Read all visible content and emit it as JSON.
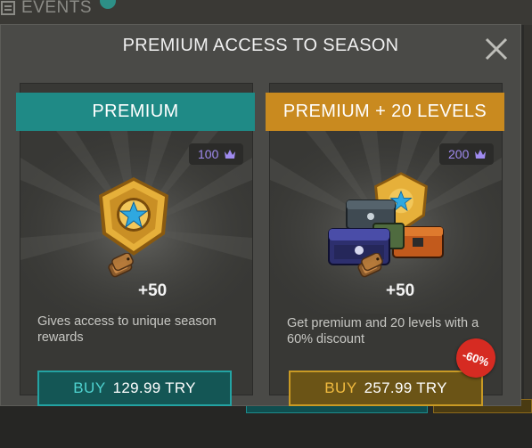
{
  "background": {
    "events_label": "EVENTS"
  },
  "modal": {
    "title": "PREMIUM ACCESS TO SEASON",
    "close_icon": "close-icon"
  },
  "cards": [
    {
      "header": "PREMIUM",
      "header_color": "#1f8a86",
      "points": "100",
      "points_icon": "crown-icon",
      "art_icon": "gold-star-badge",
      "reward_icon": "dog-tag-icon",
      "reward_amount": "+50",
      "description": "Gives access to unique season rewards",
      "buy_word": "BUY",
      "price": "129.99 TRY"
    },
    {
      "header": "PREMIUM + 20 LEVELS",
      "header_color": "#c98a1f",
      "points": "200",
      "points_icon": "crown-icon",
      "art_icon": "gold-star-badge-with-crates",
      "reward_icon": "dog-tag-icon",
      "reward_amount": "+50",
      "description": "Get premium and 20 levels with a 60% discount",
      "buy_word": "BUY",
      "price": "257.99 TRY",
      "discount": "-60%"
    }
  ]
}
